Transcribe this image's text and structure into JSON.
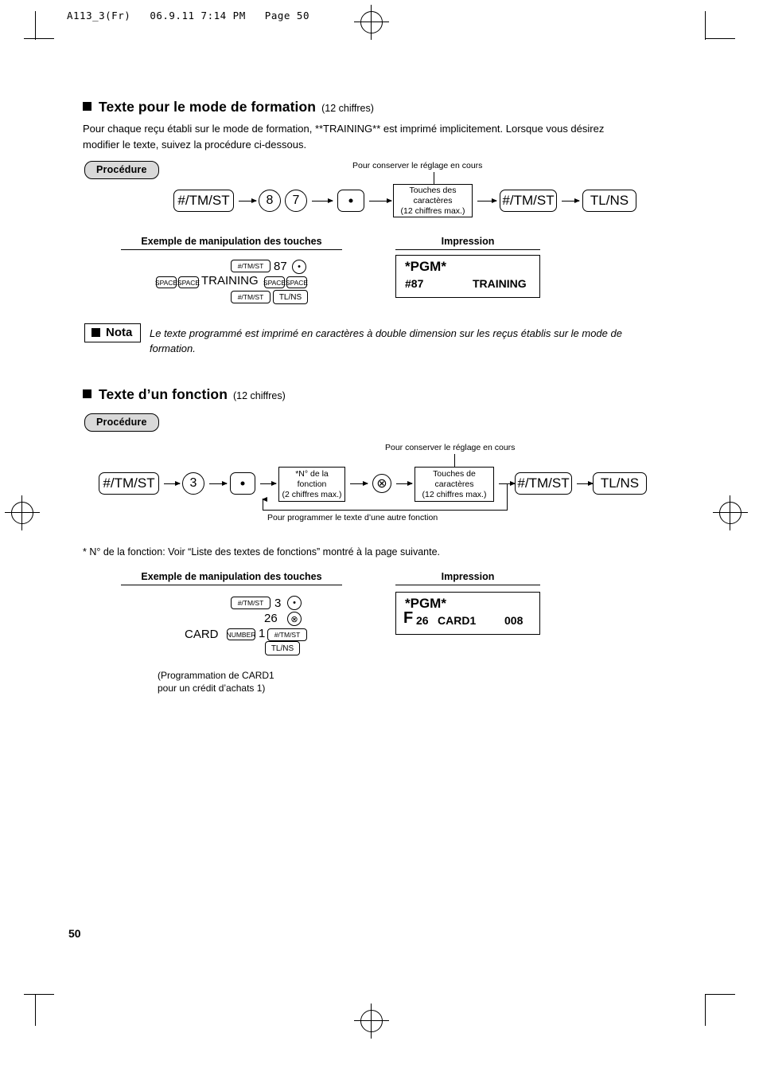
{
  "header": {
    "text": "A113_3(Fr)   06.9.11 7:14 PM   Page 50"
  },
  "page_number": "50",
  "section1": {
    "title": "Texte pour le mode de formation",
    "subtitle": "(12 chiffres)",
    "paragraph": "Pour chaque reçu établi sur le mode de formation, **TRAINING** est imprimé implicitement. Lorsque vous désirez modifier le texte, suivez la procédure ci-dessous.",
    "procedure_label": "Procédure",
    "flow": {
      "keep_setting_note": "Pour conserver le réglage en cours",
      "key1": "#/TM/ST",
      "key2": "8",
      "key3": "7",
      "key4": "•",
      "chars_box_line1": "Touches des",
      "chars_box_line2": "caractères",
      "chars_box_line3": "(12 chiffres max.)",
      "key5": "#/TM/ST",
      "key6": "TL/NS"
    },
    "example": {
      "title": "Exemple de manipulation des touches",
      "row1_key": "#/TM/ST",
      "row1_num": "87",
      "row1_dot": "•",
      "row2_space1": "SPACE",
      "row2_space2": "SPACE",
      "row2_text": "TRAINING",
      "row2_space3": "SPACE",
      "row2_space4": "SPACE",
      "row3_key": "#/TM/ST",
      "row4_key": "TL/NS"
    },
    "print": {
      "title": "Impression",
      "line1": "*PGM*",
      "line2_left": "#87",
      "line2_right": "TRAINING"
    },
    "nota": {
      "label": "Nota",
      "text": "Le texte programmé est imprimé en caractères à double dimension sur les reçus établis sur le mode de formation."
    }
  },
  "section2": {
    "title": "Texte d’un fonction",
    "subtitle": "(12 chiffres)",
    "procedure_label": "Procédure",
    "flow": {
      "keep_setting_note": "Pour conserver le réglage en cours",
      "other_function_note": "Pour programmer le texte d’une autre fonction",
      "key1": "#/TM/ST",
      "key2": "3",
      "key3": "•",
      "fn_box_line1": "*N° de la",
      "fn_box_line2": "fonction",
      "fn_box_line3": "(2 chiffres max.)",
      "multiply": "⊗",
      "chars_box_line1": "Touches de",
      "chars_box_line2": "caractères",
      "chars_box_line3": "(12 chiffres max.)",
      "key4": "#/TM/ST",
      "key5": "TL/NS"
    },
    "footnote": "* N° de la fonction: Voir “Liste des textes de fonctions” montré à la page suivante.",
    "example": {
      "title": "Exemple de manipulation des touches",
      "row1_key": "#/TM/ST",
      "row1_num": "3",
      "row1_dot": "•",
      "row2_num": "26",
      "row2_mult": "⊗",
      "row3_text": "CARD",
      "row3_key": "NUMBER",
      "row3_num": "1",
      "row3_key2": "#/TM/ST",
      "row4_key": "TL/NS",
      "caption_line1": "(Programmation de CARD1",
      "caption_line2": "pour un crédit d’achats 1)"
    },
    "print": {
      "title": "Impression",
      "line1": "*PGM*",
      "line2_f": "F",
      "line2_num": "26",
      "line2_mid": "CARD1",
      "line2_right": "008"
    }
  }
}
